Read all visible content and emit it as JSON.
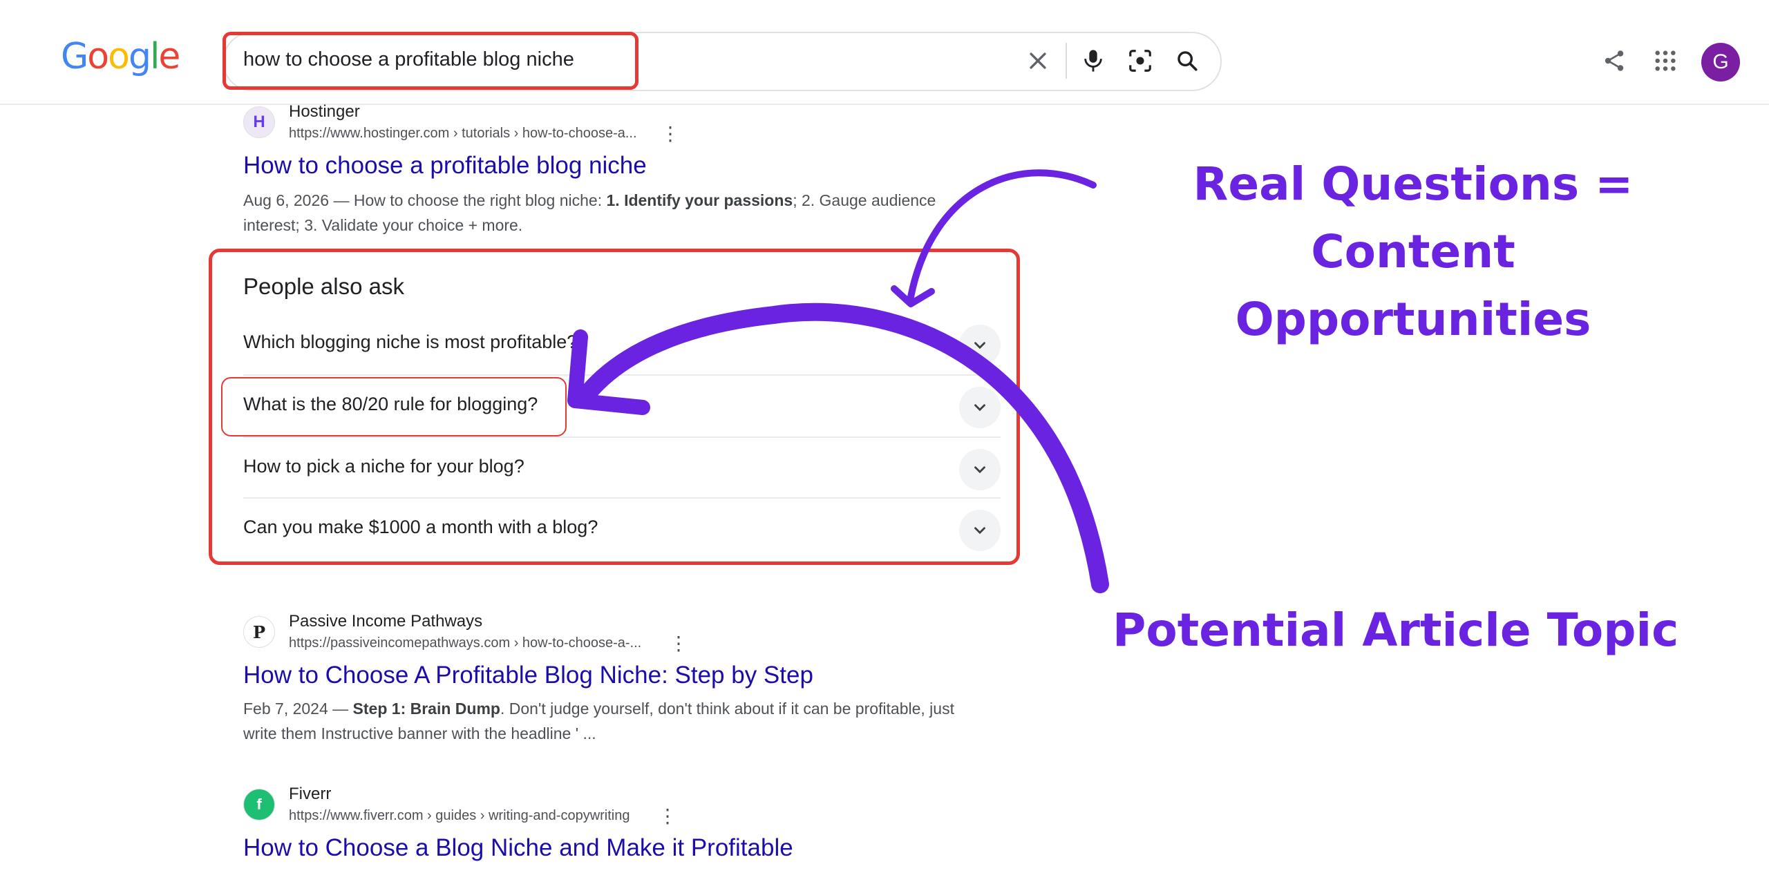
{
  "search": {
    "logo": [
      "G",
      "o",
      "o",
      "g",
      "l",
      "e"
    ],
    "query": "how to choose a profitable blog niche"
  },
  "header": {
    "avatar_letter": "G"
  },
  "results": [
    {
      "site": "Hostinger",
      "url": "https://www.hostinger.com › tutorials › how-to-choose-a...",
      "title": "How to choose a profitable blog niche",
      "snippet_date": "Aug 6, 2026 — How to choose the right blog niche: ",
      "snippet_bold": "1. Identify your passions",
      "snippet_rest": "; 2. Gauge audience interest; 3. Validate your choice + more.",
      "favicon": "H"
    },
    {
      "site": "Passive Income Pathways",
      "url": "https://passiveincomepathways.com › how-to-choose-a-...",
      "title": "How to Choose A Profitable Blog Niche: Step by Step",
      "snippet_date": "Feb 7, 2024 — ",
      "snippet_bold": "Step 1: Brain Dump",
      "snippet_rest": ". Don't judge yourself, don't think about if it can be profitable, just write them Instructive banner with the headline ' ...",
      "favicon": "P"
    },
    {
      "site": "Fiverr",
      "url": "https://www.fiverr.com › guides › writing-and-copywriting",
      "title": "How to Choose a Blog Niche and Make it Profitable",
      "favicon": "f"
    }
  ],
  "paa": {
    "title": "People also ask",
    "questions": [
      "Which blogging niche is most profitable?",
      "What is the 80/20 rule for blogging?",
      "How to pick a niche for your blog?",
      "Can you make $1000 a month with a blog?"
    ]
  },
  "annotations": {
    "line1": "Real Questions = Content",
    "line2": "Opportunities",
    "topic": "Potential Article Topic"
  },
  "colors": {
    "accent": "#6a23e0",
    "highlight": "#e53935",
    "link": "#1a0dab"
  }
}
